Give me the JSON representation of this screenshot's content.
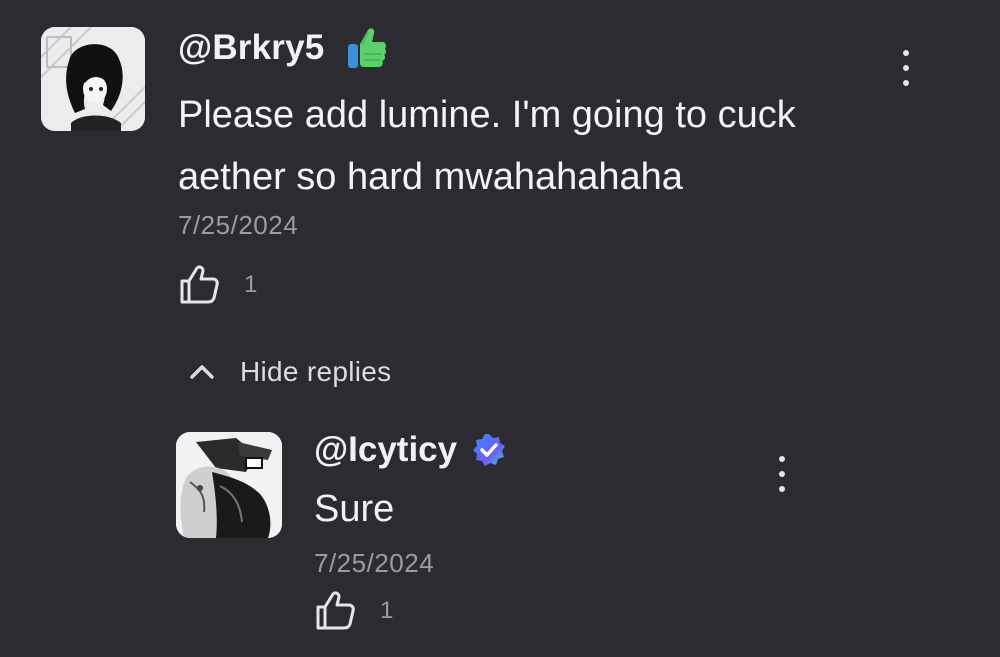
{
  "comment": {
    "username": "@Brkry5",
    "badge_icon": "thumbs-up-emoji-icon",
    "text": "Please add lumine. I'm going to cuck aether so hard mwahahahaha",
    "date": "7/25/2024",
    "like_count": "1"
  },
  "replies_toggle": {
    "label": "Hide replies",
    "icon": "chevron-up-icon"
  },
  "reply": {
    "username": "@Icyticy",
    "badge_icon": "verified-icon",
    "text": "Sure",
    "date": "7/25/2024",
    "like_count": "1"
  },
  "colors": {
    "background": "#2b2b31",
    "text_primary": "#f2f2f4",
    "text_secondary": "#9b9ba3",
    "emoji_green": "#5bd16b",
    "verified_blue": "#3d8bff"
  }
}
